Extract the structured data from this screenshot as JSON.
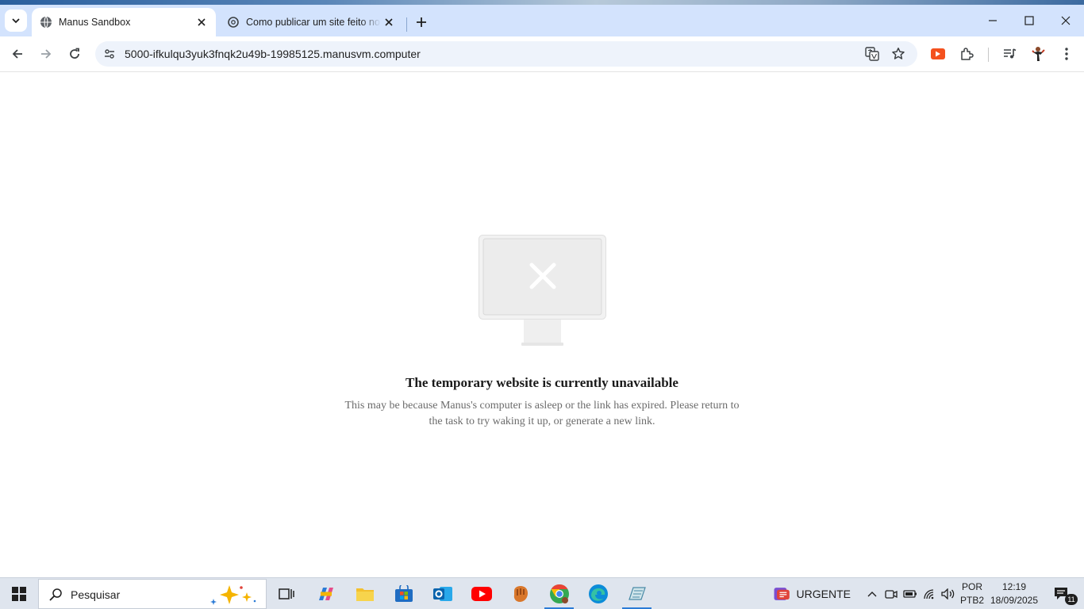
{
  "browser": {
    "tabs": [
      {
        "title": "Manus Sandbox",
        "active": true
      },
      {
        "title": "Como publicar um site feito no",
        "active": false
      }
    ],
    "url": "5000-ifkulqu3yuk3fnqk2u49b-19985125.manusvm.computer"
  },
  "page": {
    "heading": "The temporary website is currently unavailable",
    "description": "This may be because Manus's computer is asleep or the link has expired. Please return to the task to try waking it up, or generate a new link."
  },
  "taskbar": {
    "search_placeholder": "Pesquisar",
    "widget_label": "URGENTE",
    "lang_top": "POR",
    "lang_bottom": "PTB2",
    "time": "12:19",
    "date": "18/09/2025",
    "notification_count": "11"
  },
  "colors": {
    "tabbar_bg": "#d3e3fd",
    "omnibox_bg": "#eef3fb",
    "taskbar_bg": "#dfe5ee",
    "accent": "#2b7bd6"
  }
}
